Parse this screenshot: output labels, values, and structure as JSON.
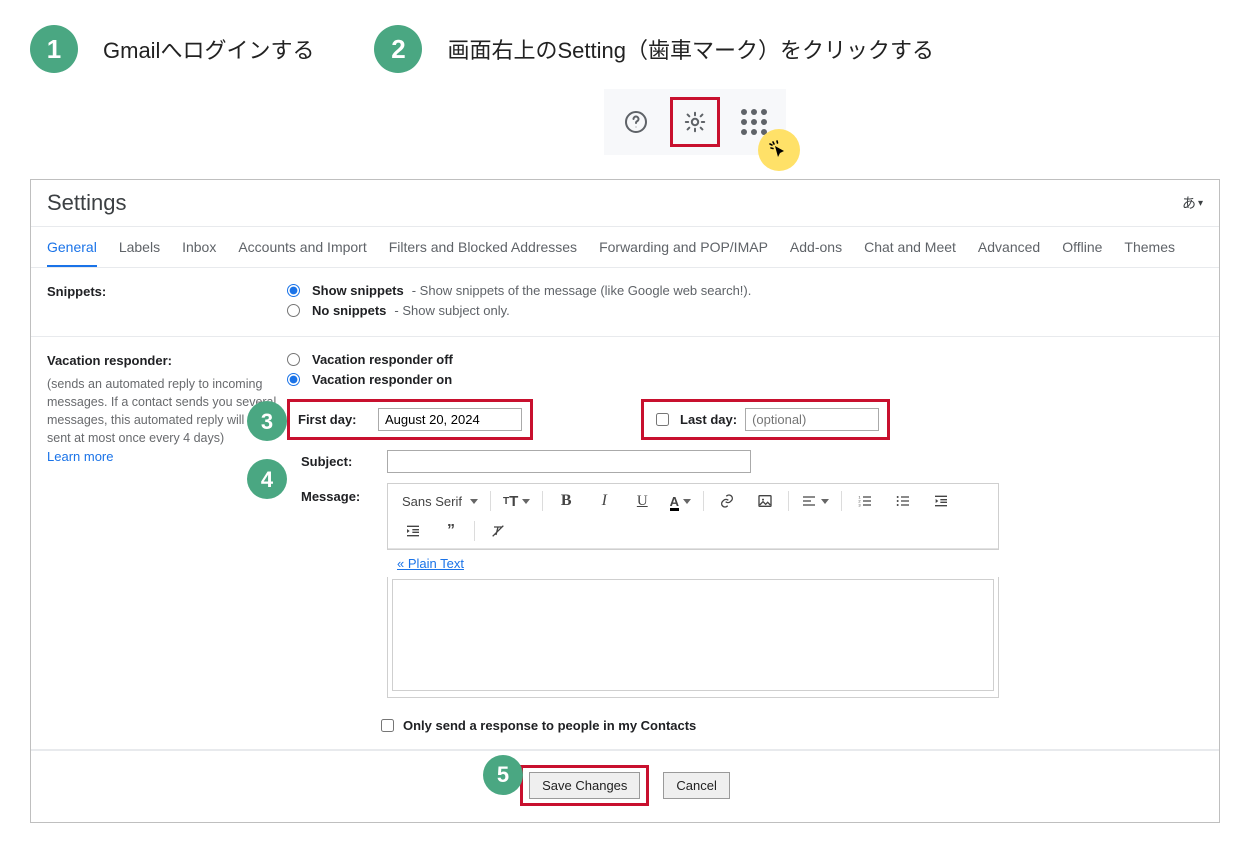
{
  "steps": {
    "s1": {
      "num": "1",
      "text": "Gmailへログインする"
    },
    "s2": {
      "num": "2",
      "text": "画面右上のSetting（歯車マーク）をクリックする"
    }
  },
  "settings": {
    "title": "Settings",
    "lang": "あ",
    "tabs": [
      "General",
      "Labels",
      "Inbox",
      "Accounts and Import",
      "Filters and Blocked Addresses",
      "Forwarding and POP/IMAP",
      "Add-ons",
      "Chat and Meet",
      "Advanced",
      "Offline",
      "Themes"
    ],
    "snippets": {
      "label": "Snippets:",
      "show": {
        "label": "Show snippets",
        "desc": " - Show snippets of the message (like Google web search!)."
      },
      "hide": {
        "label": "No snippets",
        "desc": " - Show subject only."
      }
    },
    "vacation": {
      "label": "Vacation responder:",
      "desc": "(sends an automated reply to incoming messages. If a contact sends you several messages, this automated reply will be sent at most once every 4 days)",
      "learn": "Learn more",
      "off": "Vacation responder off",
      "on": "Vacation responder on",
      "first_day_label": "First day:",
      "first_day_value": "August 20, 2024",
      "last_day_label": "Last day:",
      "last_day_placeholder": "(optional)",
      "subject_label": "Subject:",
      "message_label": "Message:",
      "font": "Sans Serif",
      "plain": "« Plain Text",
      "contacts_only": "Only send a response to people in my Contacts"
    },
    "actions": {
      "save": "Save Changes",
      "cancel": "Cancel"
    }
  },
  "badges": {
    "b3": "3",
    "b4": "4",
    "b5": "5"
  }
}
